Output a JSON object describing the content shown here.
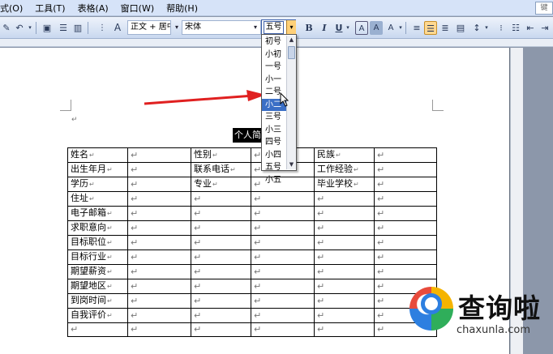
{
  "menubar": {
    "items": [
      "式(O)",
      "工具(T)",
      "表格(A)",
      "窗口(W)",
      "帮助(H)"
    ],
    "help_placeholder": "键"
  },
  "toolbar": {
    "style_value": "正文 + 居中",
    "font_value": "宋体",
    "font_size_value": "五号",
    "bold_label": "B",
    "italic_label": "I",
    "underline_label": "U",
    "font_color_label": "A",
    "highlight_label": "A",
    "char_scale_label": "A"
  },
  "document": {
    "title": "个人简",
    "table": {
      "rows": [
        [
          "姓名",
          "",
          "性别",
          "",
          "民族",
          "",
          ""
        ],
        [
          "出生年月",
          "",
          "联系电话",
          "",
          "工作经验",
          "",
          ""
        ],
        [
          "学历",
          "",
          "专业",
          "",
          "毕业学校",
          "",
          ""
        ],
        [
          "住址",
          "",
          "",
          "",
          "",
          "",
          ""
        ],
        [
          "电子邮箱",
          "",
          "",
          "",
          "",
          "",
          ""
        ],
        [
          "求职意向",
          "",
          "",
          "",
          "",
          "",
          ""
        ],
        [
          "目标职位",
          "",
          "",
          "",
          "",
          "",
          ""
        ],
        [
          "目标行业",
          "",
          "",
          "",
          "",
          "",
          ""
        ],
        [
          "期望薪资",
          "",
          "",
          "",
          "",
          "",
          ""
        ],
        [
          "期望地区",
          "",
          "",
          "",
          "",
          "",
          ""
        ],
        [
          "到岗时间",
          "",
          "",
          "",
          "",
          "",
          ""
        ],
        [
          "自我评价",
          "",
          "",
          "",
          "",
          "",
          ""
        ],
        [
          "",
          "",
          "",
          "",
          "",
          "",
          ""
        ]
      ]
    }
  },
  "font_size_dropdown": {
    "options": [
      "初号",
      "小初",
      "一号",
      "小一",
      "二号",
      "小二",
      "三号",
      "小三",
      "四号",
      "小四",
      "五号",
      "小五"
    ],
    "highlighted": "小二"
  },
  "watermark": {
    "name": "查询啦",
    "domain": "chaxunla.com"
  },
  "colors": {
    "arrow": "#e02020",
    "selection": "#3b6fc6",
    "active_button": "#ffd890"
  }
}
